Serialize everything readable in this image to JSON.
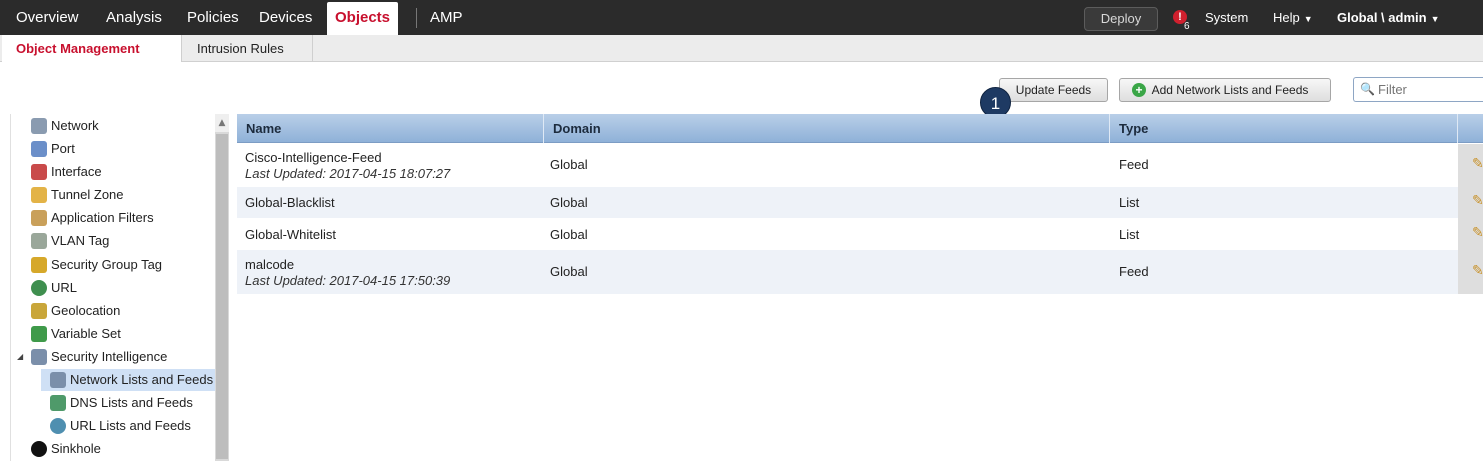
{
  "topnav": {
    "items": [
      "Overview",
      "Analysis",
      "Policies",
      "Devices",
      "Objects",
      "AMP"
    ],
    "active": "Objects",
    "deploy_label": "Deploy",
    "alert_symbol": "!",
    "alert_count": "6",
    "system_label": "System",
    "help_label": "Help",
    "user_label": "Global \\ admin",
    "caret": "▼"
  },
  "subtabs": [
    "Object Management",
    "Intrusion Rules"
  ],
  "toolbar": {
    "update_feeds_label": "Update Feeds",
    "add_label": "Add Network Lists and Feeds",
    "filter_placeholder": "Filter",
    "badge": "1"
  },
  "sidebar": {
    "items": [
      {
        "label": "Network",
        "icon": "network-icon",
        "color": "#8a9bb0"
      },
      {
        "label": "Port",
        "icon": "port-icon",
        "color": "#6b8fc9"
      },
      {
        "label": "Interface",
        "icon": "interface-icon",
        "color": "#c94a4a"
      },
      {
        "label": "Tunnel Zone",
        "icon": "tunnel-zone-icon",
        "color": "#e3b347"
      },
      {
        "label": "Application Filters",
        "icon": "application-filters-icon",
        "color": "#c9a05a"
      },
      {
        "label": "VLAN Tag",
        "icon": "vlan-tag-icon",
        "color": "#9aa79a"
      },
      {
        "label": "Security Group Tag",
        "icon": "security-group-tag-icon",
        "color": "#d6a82a"
      },
      {
        "label": "URL",
        "icon": "url-icon",
        "color": "#3f8f4f"
      },
      {
        "label": "Geolocation",
        "icon": "geolocation-icon",
        "color": "#c9a63a"
      },
      {
        "label": "Variable Set",
        "icon": "variable-set-icon",
        "color": "#3f9a4a"
      },
      {
        "label": "Security Intelligence",
        "icon": "security-intelligence-icon",
        "color": "#7b8faa",
        "expander": "◢"
      },
      {
        "label": "Network Lists and Feeds",
        "icon": "network-lists-icon",
        "color": "#7b8faa",
        "selected": true
      },
      {
        "label": "DNS Lists and Feeds",
        "icon": "dns-lists-icon",
        "color": "#4f9a6a"
      },
      {
        "label": "URL Lists and Feeds",
        "icon": "url-lists-icon",
        "color": "#4f8fb0"
      },
      {
        "label": "Sinkhole",
        "icon": "sinkhole-icon",
        "color": "#111111"
      }
    ]
  },
  "table": {
    "headers": [
      "Name",
      "Domain",
      "Type"
    ],
    "rows": [
      {
        "name": "Cisco-Intelligence-Feed",
        "sub": "Last Updated: 2017-04-15 18:07:27",
        "domain": "Global",
        "type": "Feed"
      },
      {
        "name": "Global-Blacklist",
        "sub": "",
        "domain": "Global",
        "type": "List"
      },
      {
        "name": "Global-Whitelist",
        "sub": "",
        "domain": "Global",
        "type": "List"
      },
      {
        "name": "malcode",
        "sub": "Last Updated: 2017-04-15 17:50:39",
        "domain": "Global",
        "type": "Feed"
      }
    ]
  }
}
